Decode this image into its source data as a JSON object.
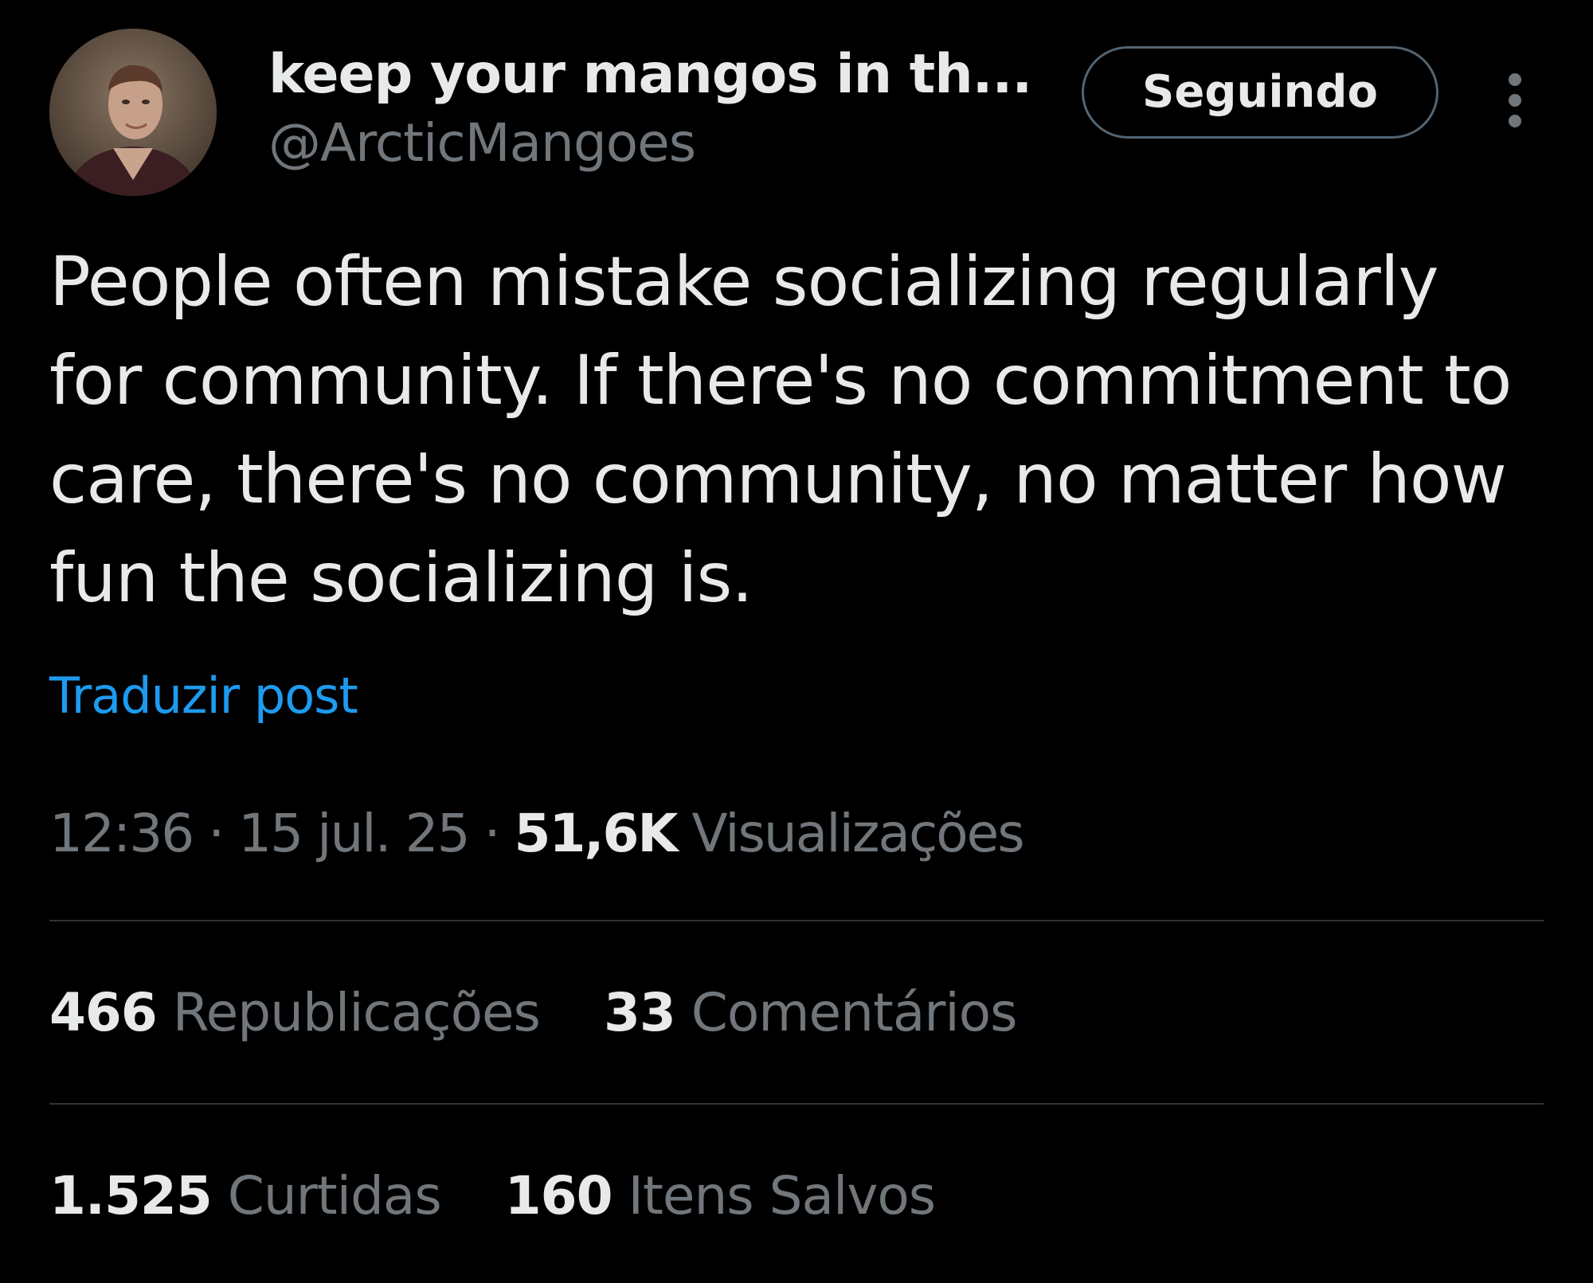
{
  "author": {
    "display_name": "keep your mangos in th...",
    "handle": "@ArcticMangoes",
    "avatar_icon": "profile-photo"
  },
  "follow_button": {
    "label": "Seguindo"
  },
  "more_icon": "vertical-ellipsis-icon",
  "post": {
    "text": "People often mistake socializing regularly for community. If there's no commitment to care, there's no community, no matter how fun the socializing is.",
    "translate_label": "Traduzir post"
  },
  "meta": {
    "time": "12:36",
    "separator": "·",
    "date": "15 jul. 25",
    "views_count": "51,6K",
    "views_label": "Visualizações"
  },
  "stats": {
    "reposts": {
      "count": "466",
      "label": "Republicações"
    },
    "comments": {
      "count": "33",
      "label": "Comentários"
    },
    "likes": {
      "count": "1.525",
      "label": "Curtidas"
    },
    "bookmarks": {
      "count": "160",
      "label": "Itens Salvos"
    }
  },
  "colors": {
    "background": "#000000",
    "primary_text": "#e7e9ea",
    "secondary_text": "#71767b",
    "link": "#1d9bf0",
    "divider": "#2f3336"
  }
}
